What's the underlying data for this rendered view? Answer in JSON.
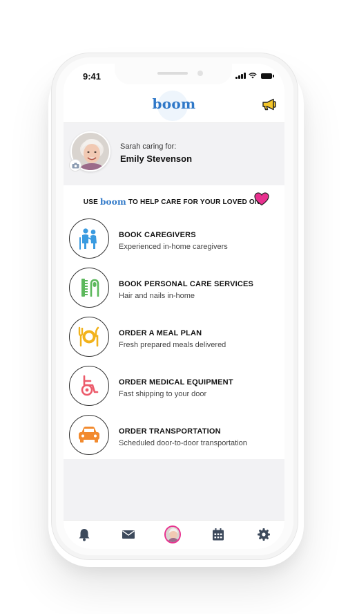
{
  "status_bar": {
    "time": "9:41"
  },
  "header": {
    "logo": "boom",
    "megaphone_icon": "megaphone-icon"
  },
  "profile": {
    "caring_for_label": "Sarah caring for:",
    "patient_name": "Emily Stevenson",
    "camera_icon": "camera-icon"
  },
  "tagline": {
    "prefix": "USE",
    "brand": "boom",
    "suffix": "TO HELP CARE FOR YOUR LOVED ONE",
    "heart_icon": "heart-icon",
    "heart_color": "#e8318f"
  },
  "services": [
    {
      "title": "BOOK CAREGIVERS",
      "subtitle": "Experienced in-home caregivers",
      "icon": "caregiver-icon",
      "color": "#3a9be0"
    },
    {
      "title": "BOOK PERSONAL CARE SERVICES",
      "subtitle": "Hair and nails in-home",
      "icon": "comb-nail-icon",
      "color": "#5cb85c"
    },
    {
      "title": "ORDER A MEAL PLAN",
      "subtitle": "Fresh prepared meals delivered",
      "icon": "meal-plate-icon",
      "color": "#f2b21b"
    },
    {
      "title": "ORDER MEDICAL EQUIPMENT",
      "subtitle": "Fast shipping to your door",
      "icon": "wheelchair-icon",
      "color": "#ec5b6b"
    },
    {
      "title": "ORDER TRANSPORTATION",
      "subtitle": "Scheduled door-to-door transportation",
      "icon": "car-icon",
      "color": "#f28a2e"
    }
  ],
  "tab_bar": {
    "items": [
      "bell-icon",
      "mail-icon",
      "profile-avatar",
      "calendar-icon",
      "gear-icon"
    ],
    "active_color": "#e8318f"
  }
}
